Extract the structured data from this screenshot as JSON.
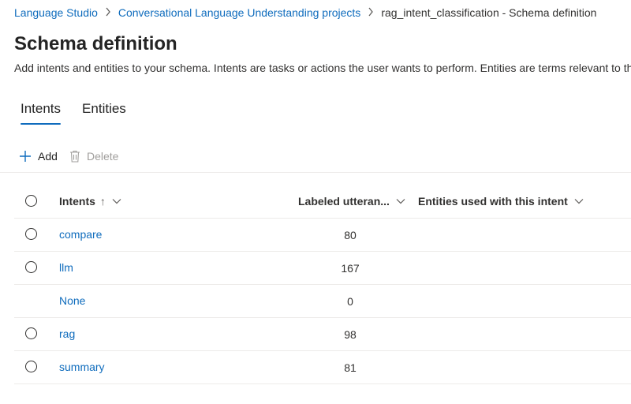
{
  "breadcrumb": {
    "items": [
      "Language Studio",
      "Conversational Language Understanding projects"
    ],
    "current": "rag_intent_classification - Schema definition"
  },
  "page": {
    "title": "Schema definition",
    "description": "Add intents and entities to your schema. Intents are tasks or actions the user wants to perform. Entities are terms relevant to the user’s intent."
  },
  "tabs": [
    {
      "label": "Intents",
      "active": true
    },
    {
      "label": "Entities",
      "active": false
    }
  ],
  "toolbar": {
    "add_label": "Add",
    "delete_label": "Delete"
  },
  "table": {
    "columns": {
      "intents": "Intents",
      "sort_indicator": "↑",
      "labeled": "Labeled utteran...",
      "entities": "Entities used with this intent"
    },
    "rows": [
      {
        "name": "compare",
        "count": "80",
        "selectable": true
      },
      {
        "name": "llm",
        "count": "167",
        "selectable": true
      },
      {
        "name": "None",
        "count": "0",
        "selectable": false
      },
      {
        "name": "rag",
        "count": "98",
        "selectable": true
      },
      {
        "name": "summary",
        "count": "81",
        "selectable": true
      }
    ]
  },
  "colors": {
    "accent": "#0f6cbd",
    "text": "#242424",
    "disabled": "#a19f9d",
    "divider": "#edebe9"
  },
  "icons": {
    "add": "plus-icon",
    "delete": "trash-icon",
    "sort": "arrow-up-icon",
    "column_menu": "chevron-down-icon",
    "breadcrumb_separator": "chevron-right-icon"
  }
}
